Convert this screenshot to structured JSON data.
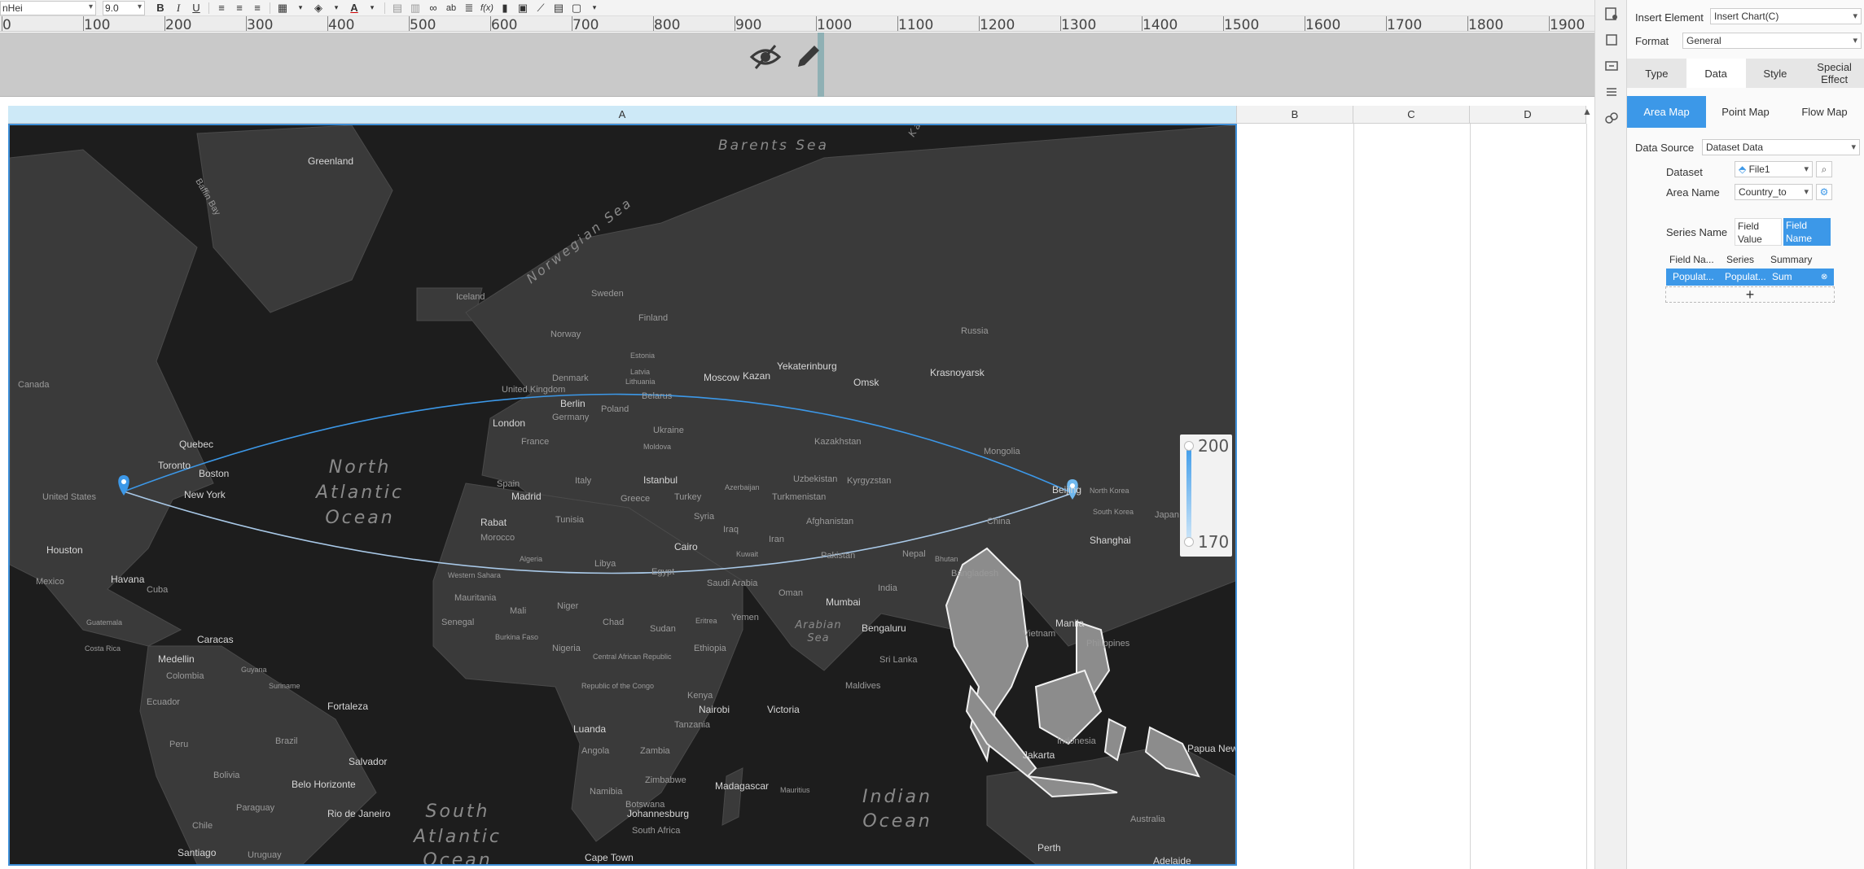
{
  "toolbar": {
    "font_name": "nHei",
    "font_size": "9.0"
  },
  "ruler": {
    "labels": [
      "0",
      "100",
      "200",
      "300",
      "400",
      "500",
      "600",
      "700",
      "800",
      "900",
      "1000",
      "1100",
      "1200",
      "1300",
      "1400",
      "1500",
      "1600",
      "1700",
      "1800",
      "1900"
    ]
  },
  "columns": {
    "a": "A",
    "b": "B",
    "c": "C",
    "d": "D"
  },
  "map": {
    "legend_max": "200",
    "legend_min": "170",
    "accent_color": "#3c98e8",
    "places": {
      "greenland": "Greenland",
      "baffin_bay": "Baffin Bay",
      "barents_sea": "Barents Sea",
      "norwegian_sea": "Norwegian Sea",
      "kara_sea": "Kara Sea",
      "iceland": "Iceland",
      "sweden": "Sweden",
      "finland": "Finland",
      "norway": "Norway",
      "estonia": "Estonia",
      "latvia": "Latvia",
      "lithuania": "Lithuania",
      "belarus": "Belarus",
      "denmark": "Denmark",
      "united_kingdom": "United Kingdom",
      "berlin": "Berlin",
      "germany": "Germany",
      "poland": "Poland",
      "ukraine": "Ukraine",
      "london": "London",
      "france": "France",
      "moldova": "Moldova",
      "spain": "Spain",
      "madrid": "Madrid",
      "italy": "Italy",
      "istanbul": "Istanbul",
      "greece": "Greece",
      "turkey": "Turkey",
      "azerbaijan": "Azerbaijan",
      "moscow": "Moscow",
      "kazan": "Kazan",
      "yekaterinburg": "Yekaterinburg",
      "omsk": "Omsk",
      "krasnoyarsk": "Krasnoyarsk",
      "russia": "Russia",
      "kazakhstan": "Kazakhstan",
      "uzbekistan": "Uzbekistan",
      "kyrgyzstan": "Kyrgyzstan",
      "turkmenistan": "Turkmenistan",
      "mongolia": "Mongolia",
      "china": "China",
      "beijing": "Beijing",
      "north_korea": "North Korea",
      "south_korea": "South Korea",
      "japan": "Japan",
      "shanghai": "Shanghai",
      "afghanistan": "Afghanistan",
      "iran": "Iran",
      "syria": "Syria",
      "iraq": "Iraq",
      "kuwait": "Kuwait",
      "pakistan": "Pakistan",
      "nepal": "Nepal",
      "bhutan": "Bhutan",
      "bangladesh": "Bangladesh",
      "india": "India",
      "mumbai": "Mumbai",
      "bengaluru": "Bengaluru",
      "sri_lanka": "Sri Lanka",
      "maldives": "Maldives",
      "saudi_arabia": "Saudi Arabia",
      "oman": "Oman",
      "yemen": "Yemen",
      "eritrea": "Eritrea",
      "ethiopia": "Ethiopia",
      "sudan": "Sudan",
      "egypt": "Egypt",
      "cairo": "Cairo",
      "libya": "Libya",
      "algeria": "Algeria",
      "tunisia": "Tunisia",
      "morocco": "Morocco",
      "rabat": "Rabat",
      "western_sahara": "Western Sahara",
      "mauritania": "Mauritania",
      "mali": "Mali",
      "niger": "Niger",
      "chad": "Chad",
      "senegal": "Senegal",
      "burkina_faso": "Burkina Faso",
      "nigeria": "Nigeria",
      "central_african_republic": "Central African Republic",
      "republic_of_congo": "Republic of the Congo",
      "kenya": "Kenya",
      "nairobi": "Nairobi",
      "tanzania": "Tanzania",
      "victoria": "Victoria",
      "luanda": "Luanda",
      "angola": "Angola",
      "zambia": "Zambia",
      "zimbabwe": "Zimbabwe",
      "namibia": "Namibia",
      "botswana": "Botswana",
      "johannesburg": "Johannesburg",
      "south_africa": "South Africa",
      "cape_town": "Cape Town",
      "madagascar": "Madagascar",
      "mauritius": "Mauritius",
      "canada": "Canada",
      "quebec": "Quebec",
      "toronto": "Toronto",
      "boston": "Boston",
      "new_york": "New York",
      "united_states": "United States",
      "houston": "Houston",
      "mexico": "Mexico",
      "havana": "Havana",
      "cuba": "Cuba",
      "guatemala": "Guatemala",
      "costa_rica": "Costa Rica",
      "caracas": "Caracas",
      "medellin": "Medellin",
      "colombia": "Colombia",
      "guyana": "Guyana",
      "suriname": "Suriname",
      "ecuador": "Ecuador",
      "peru": "Peru",
      "brazil": "Brazil",
      "fortaleza": "Fortaleza",
      "salvador": "Salvador",
      "bolivia": "Bolivia",
      "belo_horizonte": "Belo Horizonte",
      "paraguay": "Paraguay",
      "rio": "Rio de Janeiro",
      "chile": "Chile",
      "santiago": "Santiago",
      "uruguay": "Uruguay",
      "manila": "Manila",
      "philippines": "Philippines",
      "jakarta": "Jakarta",
      "indonesia": "Indonesia",
      "papua_new_guinea": "Papua New Guinea",
      "australia": "Australia",
      "perth": "Perth",
      "adelaide": "Adelaide",
      "vietnam": "Vietnam"
    },
    "oceans": {
      "north_atlantic": [
        "North",
        "Atlantic",
        "Ocean"
      ],
      "south_atlantic": [
        "South",
        "Atlantic",
        "Ocean"
      ],
      "indian": [
        "Indian",
        "Ocean"
      ],
      "arabian_sea": [
        "Arabian",
        "Sea"
      ]
    }
  },
  "panel": {
    "insert_element_label": "Insert Element",
    "insert_element_value": "Insert Chart(C)",
    "format_label": "Format",
    "format_value": "General",
    "tabs": [
      "Type",
      "Data",
      "Style",
      "Special Effect"
    ],
    "map_tabs": [
      "Area Map",
      "Point Map",
      "Flow Map"
    ],
    "data_source_label": "Data Source",
    "data_source_value": "Dataset Data",
    "dataset_label": "Dataset",
    "dataset_value": "File1",
    "area_name_label": "Area Name",
    "area_name_value": "Country_to",
    "series_name_label": "Series Name",
    "series_option_value": "Field Value",
    "series_option_name": "Field Name",
    "table_headers": [
      "Field Na...",
      "Series",
      "Summary"
    ],
    "row": {
      "field": "Populat...",
      "series": "Populat...",
      "summary": "Sum"
    },
    "add_label": "+"
  }
}
